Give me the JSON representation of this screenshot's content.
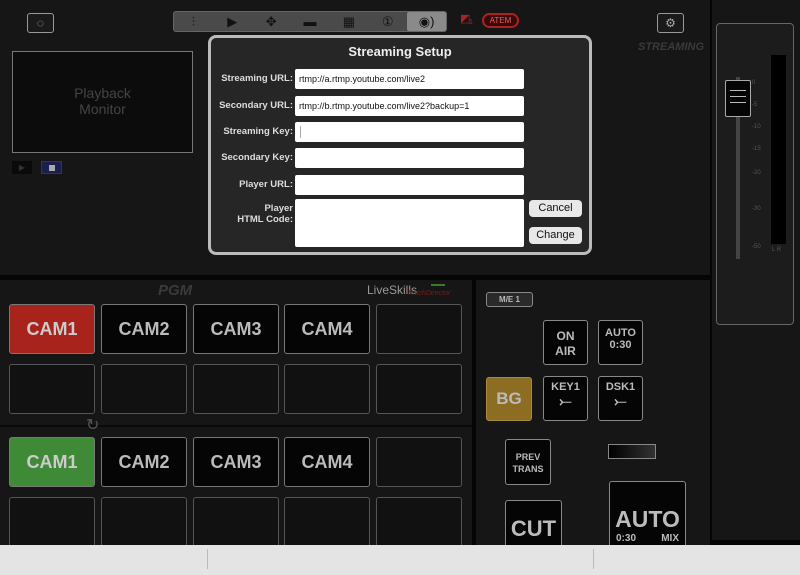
{
  "toolbar": {
    "left_icon": "spinner-icon",
    "items": [
      {
        "icon": "mixer-sliders-icon",
        "glyph": "⫶"
      },
      {
        "icon": "play-icon",
        "glyph": "▶"
      },
      {
        "icon": "move-arrows-icon",
        "glyph": "✥"
      },
      {
        "icon": "monitor-icon",
        "glyph": "▬"
      },
      {
        "icon": "multiview-icon",
        "glyph": "▦"
      },
      {
        "icon": "number-one-icon",
        "glyph": "①"
      },
      {
        "icon": "streaming-icon",
        "glyph": "◉)"
      }
    ],
    "active_item": "streaming-icon",
    "atem_label": "ATEM",
    "atem_count": "1",
    "settings_icon": "gear-icon",
    "streaming_label": "STREAMING"
  },
  "playback": {
    "label_line1": "Playback",
    "label_line2": "Monitor"
  },
  "dialog": {
    "title": "Streaming Setup",
    "fields": [
      {
        "label": "Streaming URL:",
        "value": "rtmp://a.rtmp.youtube.com/live2"
      },
      {
        "label": "Secondary URL:",
        "value": "rtmp://b.rtmp.youtube.com/live2?backup=1"
      },
      {
        "label": "Streaming Key:",
        "value": ""
      },
      {
        "label": "Secondary Key:",
        "value": ""
      },
      {
        "label": "Player URL:",
        "value": ""
      }
    ],
    "html_label_line1": "Player",
    "html_label_line2": "HTML Code:",
    "html_value": "",
    "cancel": "Cancel",
    "change": "Change"
  },
  "fader": {
    "scale": [
      "0",
      "-5",
      "-10",
      "-15",
      "-20",
      "-30",
      "-50"
    ],
    "lr": "L R"
  },
  "pgm": {
    "label": "PGM",
    "brand": "LiveSkills",
    "brand_sub": "TouchDirector",
    "program_row": [
      "CAM1",
      "CAM2",
      "CAM3",
      "CAM4",
      ""
    ],
    "preview_row": [
      "CAM1",
      "CAM2",
      "CAM3",
      "CAM4",
      ""
    ],
    "program_active": "CAM1",
    "preview_active": "CAM1"
  },
  "me": {
    "label": "M/E 1",
    "on_air": [
      "ON",
      "AIR"
    ],
    "auto_top": [
      "AUTO",
      "0:30"
    ],
    "bg": "BG",
    "key1": "KEY1",
    "dsk1": "DSK1",
    "prev_trans": [
      "PREV",
      "TRANS"
    ],
    "cut": "CUT",
    "auto": "AUTO",
    "auto_rate": "0:30",
    "auto_mix": "MIX"
  },
  "colors": {
    "program": "#a8231c",
    "preview": "#3f8a36",
    "bg": "#8c6d21"
  }
}
